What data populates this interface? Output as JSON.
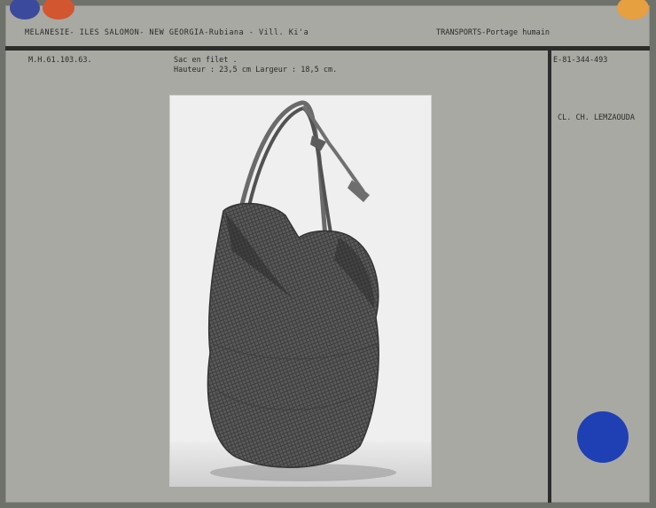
{
  "header": {
    "region": "MELANESIE- ILES SALOMON- NEW GEORGIA-Rubiana - Vill. Ki'a",
    "theme": "TRANSPORTS-Portage humain"
  },
  "record": {
    "inventory_number": "M.H.61.103.63.",
    "object_name": "Sac en filet .",
    "dimensions": "Hauteur : 23,5 cm Largeur : 18,5 cm.",
    "photo_number": "E-81-344-493",
    "photo_credit": "CL. CH. LEMZAOUDA"
  },
  "colors": {
    "card": "#a9a9a3",
    "frame": "#6f716b",
    "line": "#2c2d2b",
    "dot_blue": "#1f3fb5",
    "dot_red": "#d2562f",
    "dot_orange": "#e6a03f"
  }
}
